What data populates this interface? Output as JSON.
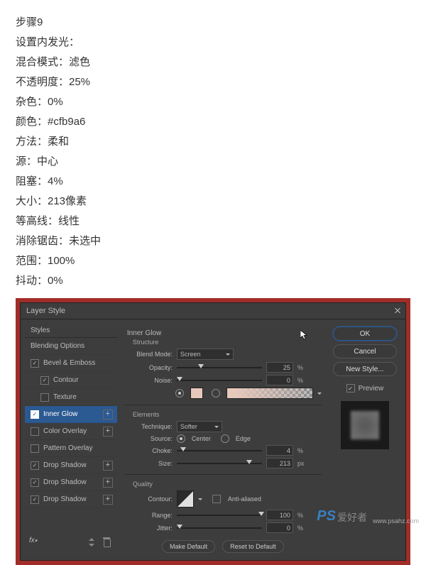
{
  "instructions": {
    "step": "步骤9",
    "title": "设置内发光：",
    "lines": [
      "混合模式：滤色",
      "不透明度：25%",
      "杂色：0%",
      "颜色：#cfb9a6",
      "方法：柔和",
      "源：中心",
      "阻塞：4%",
      "大小：213像素",
      "等高线：线性",
      "消除锯齿：未选中",
      "范围：100%",
      "抖动：0%"
    ]
  },
  "dialog": {
    "title": "Layer Style",
    "styles_header": "Styles",
    "items": {
      "blending": "Blending Options",
      "bevel": "Bevel & Emboss",
      "contour": "Contour",
      "texture": "Texture",
      "inner_glow": "Inner Glow",
      "color_overlay": "Color Overlay",
      "pattern_overlay": "Pattern Overlay",
      "drop1": "Drop Shadow",
      "drop2": "Drop Shadow",
      "drop3": "Drop Shadow"
    },
    "panel": {
      "group_title": "Inner Glow",
      "structure": "Structure",
      "blend_mode_label": "Blend Mode:",
      "blend_mode_value": "Screen",
      "opacity_label": "Opacity:",
      "opacity_value": "25",
      "noise_label": "Noise:",
      "noise_value": "0",
      "glow_color": "#e7c9bc",
      "percent": "%",
      "elements": "Elements",
      "technique_label": "Technique:",
      "technique_value": "Softer",
      "source_label": "Source:",
      "source_center": "Center",
      "source_edge": "Edge",
      "choke_label": "Choke:",
      "choke_value": "4",
      "size_label": "Size:",
      "size_value": "213",
      "px": "px",
      "quality": "Quality",
      "contour_label": "Contour:",
      "anti_aliased": "Anti-aliased",
      "range_label": "Range:",
      "range_value": "100",
      "jitter_label": "Jitter:",
      "jitter_value": "0",
      "make_default": "Make Default",
      "reset_default": "Reset to Default"
    },
    "right": {
      "ok": "OK",
      "cancel": "Cancel",
      "new_style": "New Style...",
      "preview": "Preview"
    }
  },
  "watermark": {
    "ps": "PS",
    "cn": "爱好者",
    "url": "www.psahz.com"
  }
}
